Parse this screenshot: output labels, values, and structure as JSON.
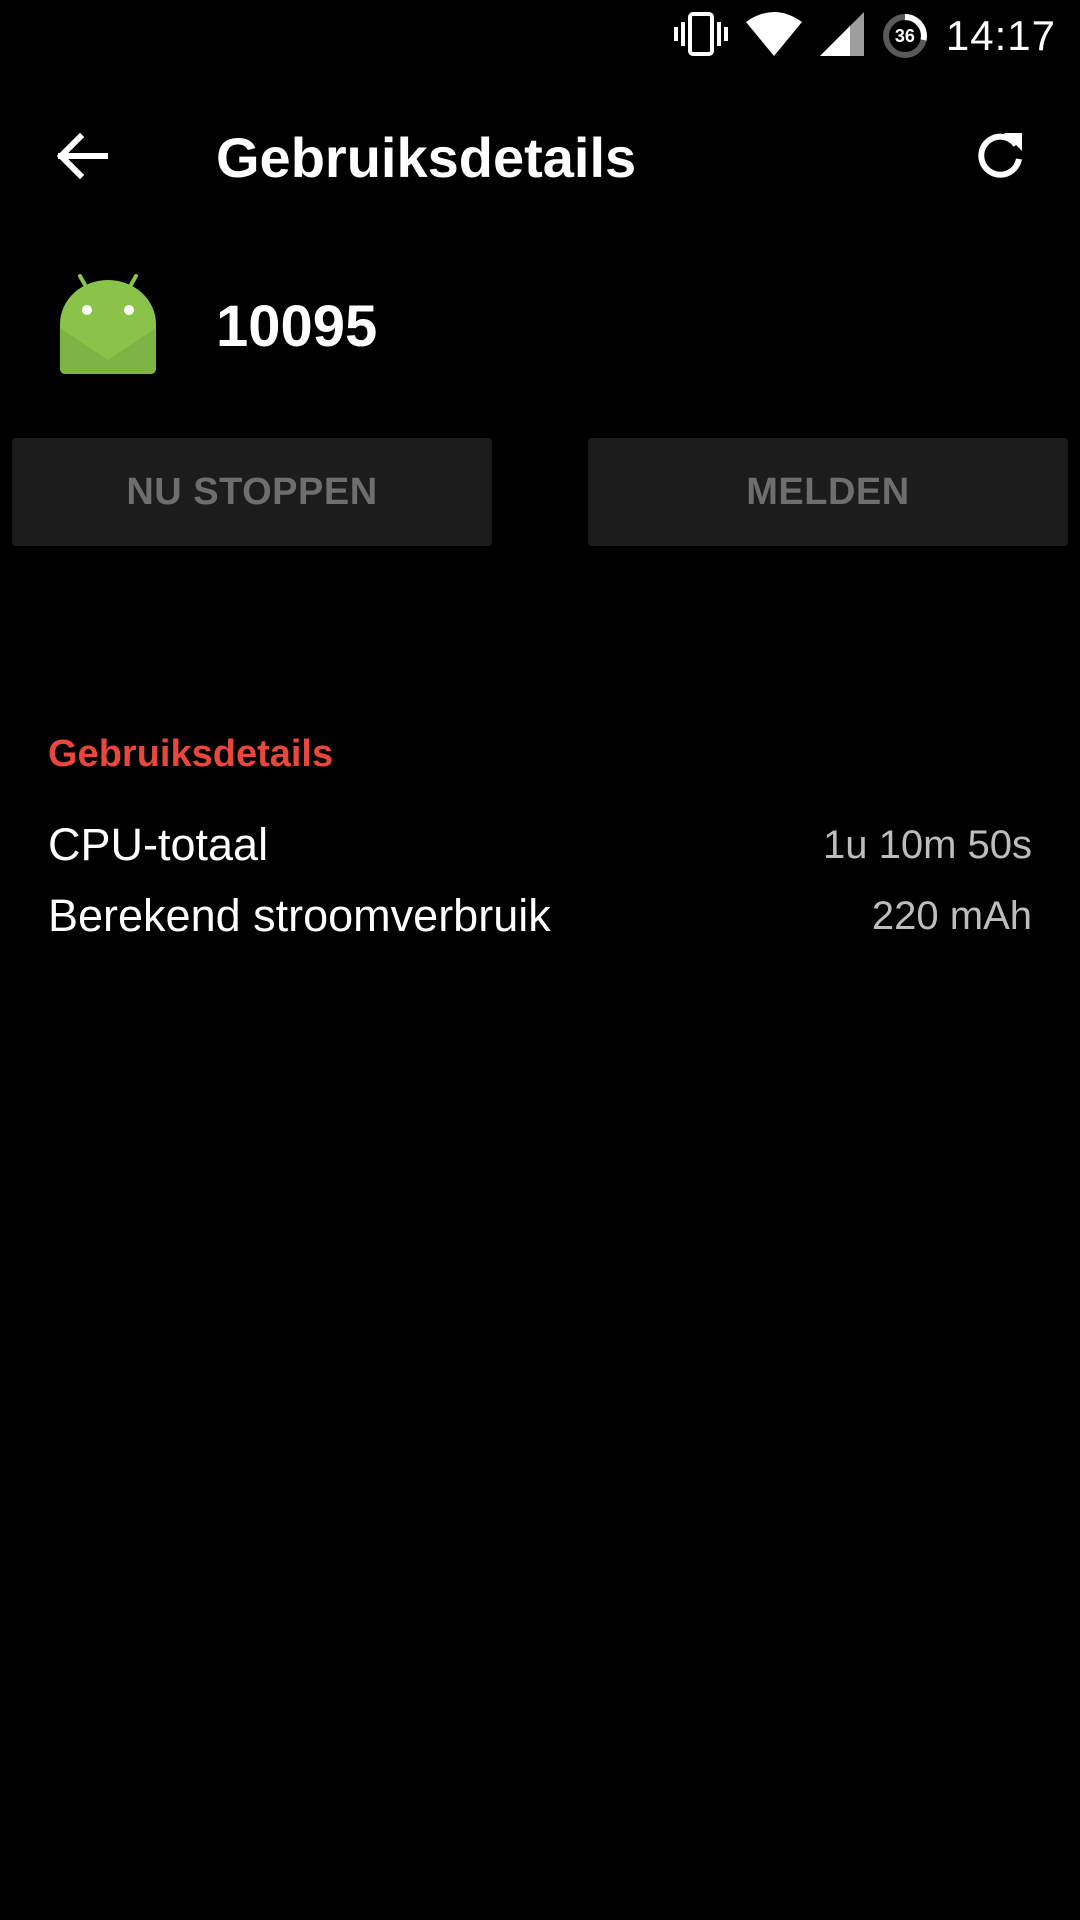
{
  "status_bar": {
    "time": "14:17",
    "battery_level": "36",
    "icons": [
      "vibrate-icon",
      "wifi-icon",
      "cell-signal-icon",
      "battery-icon"
    ]
  },
  "toolbar": {
    "title": "Gebruiksdetails",
    "back_icon": "arrow-back-icon",
    "refresh_icon": "refresh-icon"
  },
  "app": {
    "name": "10095",
    "icon": "android-icon"
  },
  "actions": {
    "stop_label": "NU STOPPEN",
    "report_label": "MELDEN"
  },
  "usage": {
    "header": "Gebruiksdetails",
    "rows": [
      {
        "label": "CPU-totaal",
        "value": "1u 10m 50s"
      },
      {
        "label": "Berekend stroomverbruik",
        "value": "220 mAh"
      }
    ]
  },
  "colors": {
    "background": "#000000",
    "accent": "#e8483c",
    "android_green": "#8bc34a",
    "button_bg": "#1c1c1c",
    "button_text": "#6e6e6e"
  }
}
